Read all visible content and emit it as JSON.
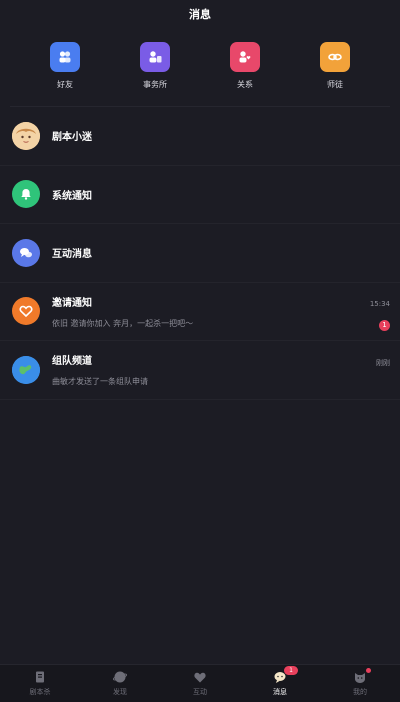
{
  "header": {
    "title": "消息"
  },
  "quick_actions": [
    {
      "label": "好友",
      "icon": "friends-icon",
      "color": "#4a7df0"
    },
    {
      "label": "事务所",
      "icon": "agency-icon",
      "color": "#7a5ce6"
    },
    {
      "label": "关系",
      "icon": "relation-icon",
      "color": "#e8486a"
    },
    {
      "label": "师徒",
      "icon": "mentor-icon",
      "color": "#f2a23a"
    }
  ],
  "messages": [
    {
      "title": "剧本小迷",
      "sub": "",
      "time": "",
      "badge": "",
      "avatar_color": "#f1c27d"
    },
    {
      "title": "系统通知",
      "sub": "",
      "time": "",
      "badge": "",
      "avatar_color": "#2fc47a"
    },
    {
      "title": "互动消息",
      "sub": "",
      "time": "",
      "badge": "",
      "avatar_color": "#5a78e8"
    },
    {
      "title": "邀请通知",
      "sub": "依旧 邀请你加入 奔月，一起杀一把吧～",
      "time": "15:34",
      "badge": "1",
      "avatar_color": "#f07a2a"
    },
    {
      "title": "组队频道",
      "sub": "曲敏才发送了一条组队申请",
      "time": "刚刚",
      "badge": "",
      "avatar_color": "#3a8ee8"
    }
  ],
  "nav": [
    {
      "label": "剧本杀",
      "icon": "script-icon"
    },
    {
      "label": "发现",
      "icon": "discover-icon"
    },
    {
      "label": "互动",
      "icon": "interact-icon"
    },
    {
      "label": "消息",
      "icon": "message-icon",
      "badge": "1"
    },
    {
      "label": "我的",
      "icon": "profile-icon"
    }
  ]
}
